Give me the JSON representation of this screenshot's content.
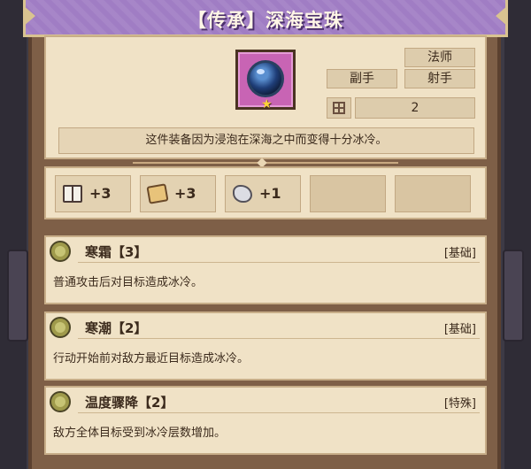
{
  "title": "【传承】深海宝珠",
  "item": {
    "icon": "blue-pearl-icon",
    "class_tag": "法师",
    "slot_tags": [
      "副手",
      "射手"
    ],
    "slot_count": "2",
    "description": "这件装备因为浸泡在深海之中而变得十分冰冷。"
  },
  "stats": [
    {
      "icon": "book-icon",
      "value": "+3"
    },
    {
      "icon": "scroll-icon",
      "value": "+3"
    },
    {
      "icon": "stone-icon",
      "value": "+1"
    }
  ],
  "effects": [
    {
      "name": "寒霜【3】",
      "type": "[基础]",
      "description": "普通攻击后对目标造成冰冷。"
    },
    {
      "name": "寒潮【2】",
      "type": "[基础]",
      "description": "行动开始前对敌方最近目标造成冰冷。"
    },
    {
      "name": "温度骤降【2】",
      "type": "[特殊]",
      "description": "敌方全体目标受到冰冷层数增加。"
    }
  ],
  "colors": {
    "title_bar": "#a07dc4",
    "panel": "#f0e2c6",
    "frame": "#7e5f47",
    "item_frame": "#c864b4"
  }
}
